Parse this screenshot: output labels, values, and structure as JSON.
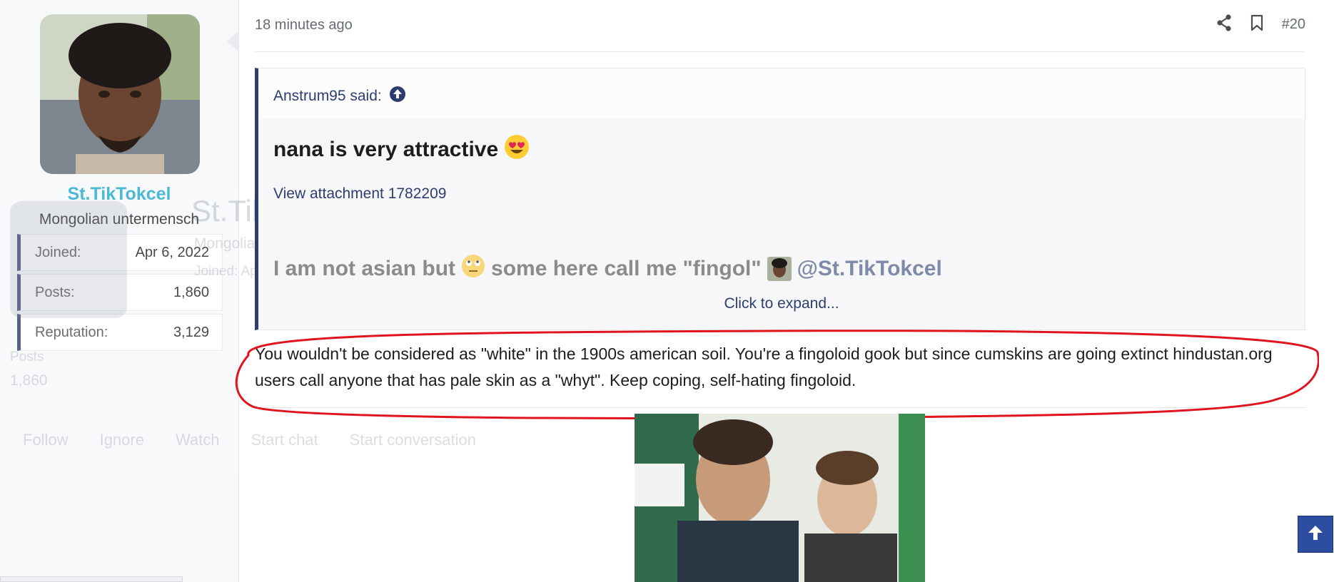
{
  "user": {
    "name": "St.TikTokcel",
    "title": "Mongolian untermensch",
    "stats": [
      {
        "label": "Joined:",
        "value": "Apr 6, 2022"
      },
      {
        "label": "Posts:",
        "value": "1,860"
      },
      {
        "label": "Reputation:",
        "value": "3,129"
      }
    ]
  },
  "tooltip_ghost": {
    "name": "St.TikTokcel",
    "title": "Mongolian untermensch",
    "joined": "Joined: Apr",
    "posts_label": "Posts",
    "posts_value": "1,860",
    "actions": [
      "Follow",
      "Ignore",
      "Watch",
      "Start chat",
      "Start conversation"
    ]
  },
  "post": {
    "time": "18 minutes ago",
    "number": "#20",
    "quote": {
      "author": "Anstrum95 said:",
      "line1": "nana is very attractive",
      "attachment": "View attachment 1782209",
      "line2_a": "I am not asian but",
      "line2_b": "some here call me \"fingol\"",
      "mention": "@St.TikTokcel",
      "expand": "Click to expand..."
    },
    "reply": "You wouldn't be considered as \"white\" in the 1900s american soil. You're a fingoloid gook but since cumskins are going extinct hindustan.org users call anyone that has pale skin as a \"whyt\". Keep coping, self-hating fingoloid."
  },
  "icons": {
    "share": "share-icon",
    "bookmark": "bookmark-icon",
    "quote_jump": "arrow-up-circle-icon",
    "scroll_top": "arrow-up-icon"
  },
  "colors": {
    "accent_navy": "#2d3e6e",
    "username": "#1fa8c9",
    "annotation": "#e0141e"
  }
}
